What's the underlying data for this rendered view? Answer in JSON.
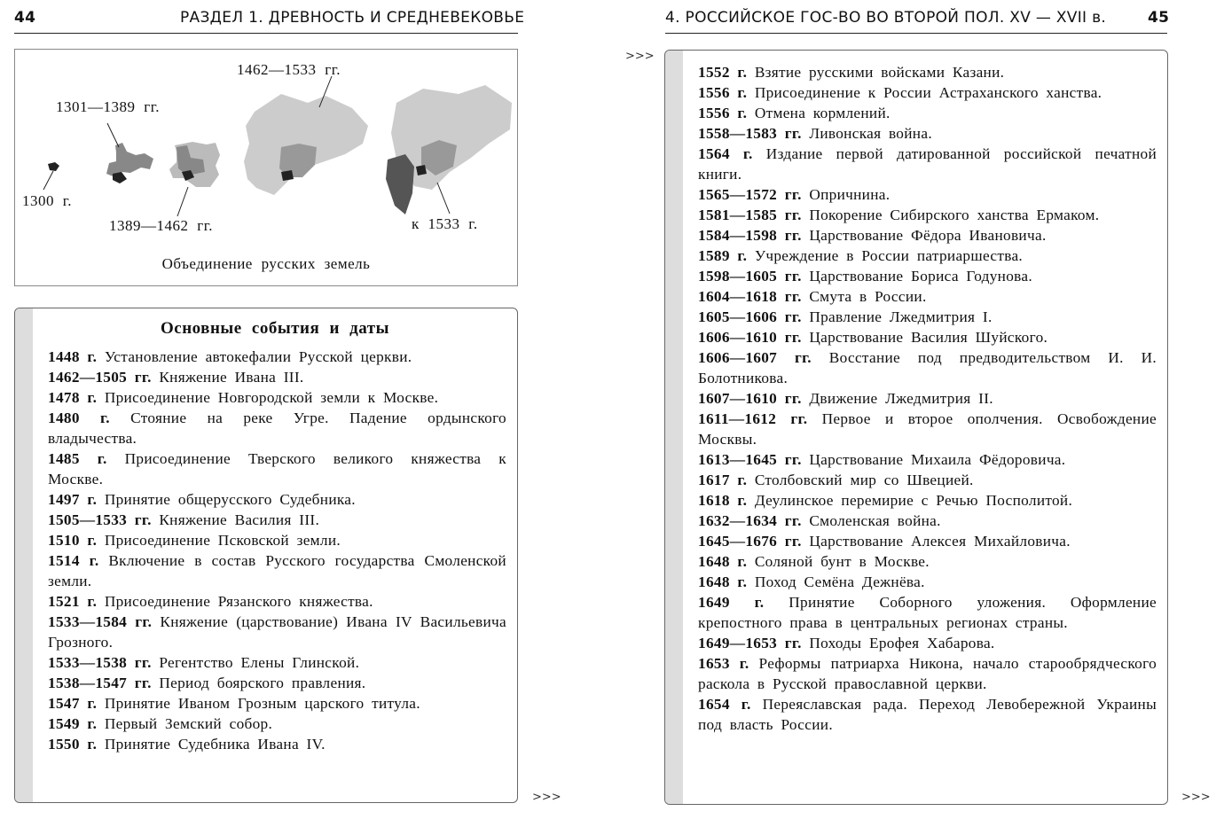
{
  "left_page": {
    "page_number": "44",
    "running_head": "РАЗДЕЛ 1. ДРЕВНОСТЬ И СРЕДНЕВЕКОВЬЕ",
    "figure": {
      "caption": "Объединение русских земель",
      "labels": [
        "1300 г.",
        "1301—1389 гг.",
        "1389—1462 гг.",
        "1462—1533 гг.",
        "к 1533 г."
      ]
    },
    "events_box": {
      "title": "Основные события и даты",
      "entries": [
        {
          "date": "1448 г.",
          "text": "Установление автокефалии Русской церкви."
        },
        {
          "date": "1462—1505 гг.",
          "text": "Княжение Ивана III."
        },
        {
          "date": "1478 г.",
          "text": "Присоединение Новгородской земли к Москве."
        },
        {
          "date": "1480 г.",
          "text": "Стояние на реке Угре. Падение ордынского владычества."
        },
        {
          "date": "1485 г.",
          "text": "Присоединение Тверского великого княжества к Москве."
        },
        {
          "date": "1497 г.",
          "text": "Принятие общерусского Судебника."
        },
        {
          "date": "1505—1533 гг.",
          "text": "Княжение Василия III."
        },
        {
          "date": "1510 г.",
          "text": "Присоединение Псковской земли."
        },
        {
          "date": "1514 г.",
          "text": "Включение в состав Русского государства Смоленской земли."
        },
        {
          "date": "1521 г.",
          "text": "Присоединение Рязанского княжества."
        },
        {
          "date": "1533—1584 гг.",
          "text": "Княжение (царствование) Ивана IV Васильевича Грозного."
        },
        {
          "date": "1533—1538 гг.",
          "text": "Регентство Елены Глинской."
        },
        {
          "date": "1538—1547 гг.",
          "text": "Период боярского правления."
        },
        {
          "date": "1547 г.",
          "text": "Принятие Иваном Грозным царского титула."
        },
        {
          "date": "1549 г.",
          "text": "Первый Земский собор."
        },
        {
          "date": "1550 г.",
          "text": "Принятие Судебника Ивана IV."
        }
      ]
    },
    "continue_mark": ">>>"
  },
  "right_page": {
    "page_number": "45",
    "running_head": "4. РОССИЙСКОЕ ГОС-ВО ВО ВТОРОЙ ПОЛ. XV — XVII в.",
    "continued_mark": ">>>",
    "entries": [
      {
        "date": "1552 г.",
        "text": "Взятие русскими войсками Казани."
      },
      {
        "date": "1556 г.",
        "text": "Присоединение к России Астраханского ханства."
      },
      {
        "date": "1556 г.",
        "text": "Отмена кормлений."
      },
      {
        "date": "1558—1583 гг.",
        "text": "Ливонская война."
      },
      {
        "date": "1564 г.",
        "text": "Издание первой датированной российской печатной книги."
      },
      {
        "date": "1565—1572 гг.",
        "text": "Опричнина."
      },
      {
        "date": "1581—1585 гг.",
        "text": "Покорение Сибирского ханства Ермаком."
      },
      {
        "date": "1584—1598 гг.",
        "text": "Царствование Фёдора Ивановича."
      },
      {
        "date": "1589 г.",
        "text": "Учреждение в России патриаршества."
      },
      {
        "date": "1598—1605 гг.",
        "text": "Царствование Бориса Годунова."
      },
      {
        "date": "1604—1618 гг.",
        "text": "Смута в России."
      },
      {
        "date": "1605—1606 гг.",
        "text": "Правление Лжедмитрия I."
      },
      {
        "date": "1606—1610 гг.",
        "text": "Царствование Василия Шуйского."
      },
      {
        "date": "1606—1607 гг.",
        "text": "Восстание под предводительством И. И. Болотникова."
      },
      {
        "date": "1607—1610 гг.",
        "text": "Движение Лжедмитрия II."
      },
      {
        "date": "1611—1612 гг.",
        "text": "Первое и второе ополчения. Освобождение Москвы."
      },
      {
        "date": "1613—1645 гг.",
        "text": "Царствование Михаила Фёдоровича."
      },
      {
        "date": "1617 г.",
        "text": "Столбовский мир со Швецией."
      },
      {
        "date": "1618 г.",
        "text": "Деулинское перемирие с Речью Посполитой."
      },
      {
        "date": "1632—1634 гг.",
        "text": "Смоленская война."
      },
      {
        "date": "1645—1676 гг.",
        "text": "Царствование Алексея Михайловича."
      },
      {
        "date": "1648 г.",
        "text": "Соляной бунт в Москве."
      },
      {
        "date": "1648 г.",
        "text": "Поход Семёна Дежнёва."
      },
      {
        "date": "1649 г.",
        "text": "Принятие Соборного уложения. Оформление крепостного права в центральных регионах страны."
      },
      {
        "date": "1649—1653 гг.",
        "text": "Походы Ерофея Хабарова."
      },
      {
        "date": "1653 г.",
        "text": "Реформы патриарха Никона, начало старообрядческого раскола в Русской православной церкви."
      },
      {
        "date": "1654 г.",
        "text": "Переяславская рада. Переход Левобережной Украины под власть России."
      }
    ],
    "continue_mark": ">>>"
  }
}
